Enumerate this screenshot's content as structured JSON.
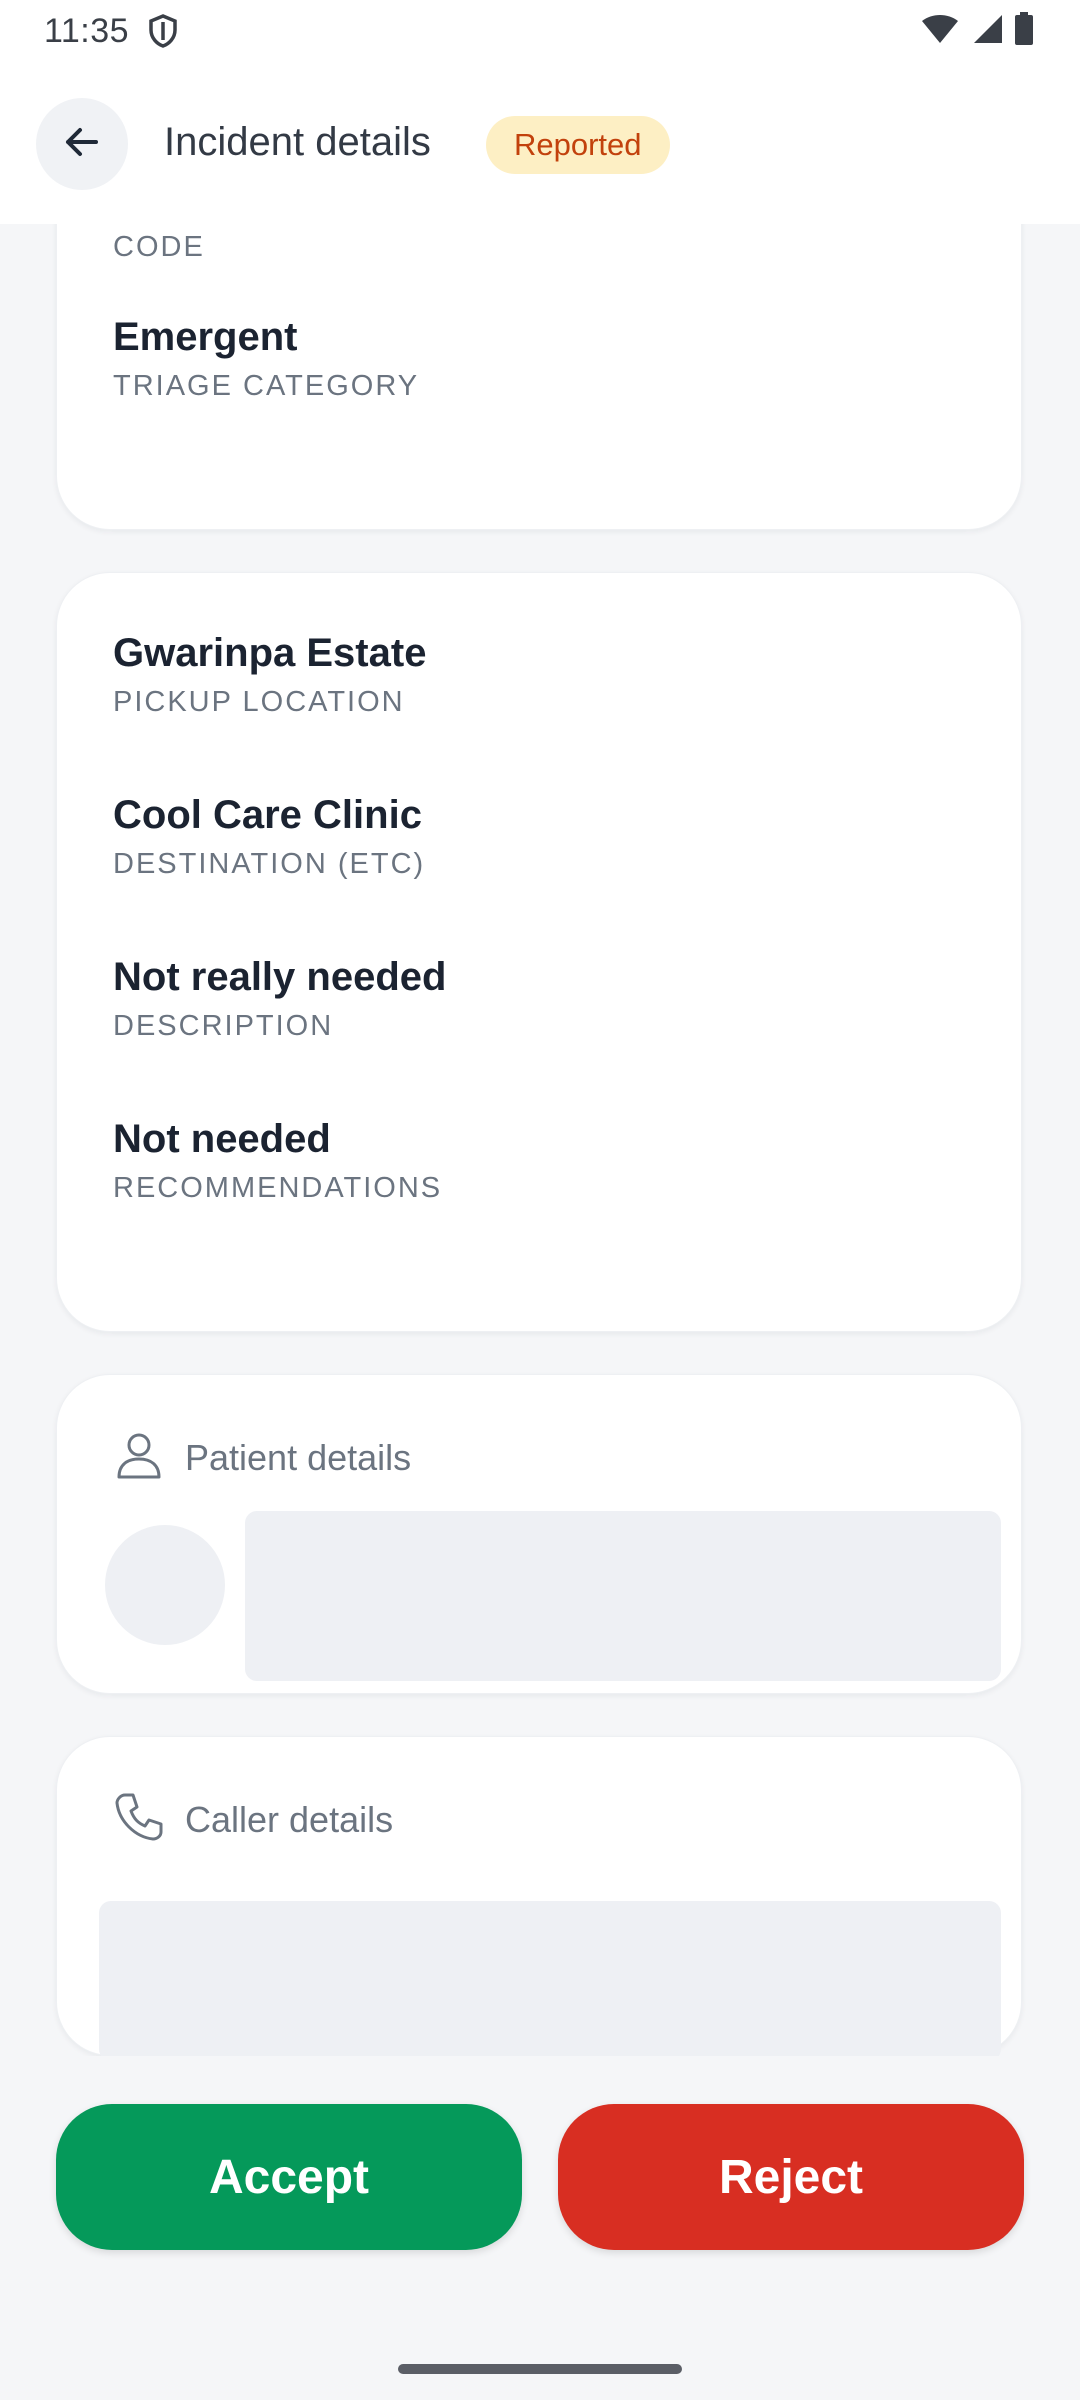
{
  "status_bar": {
    "time": "11:35",
    "icons": [
      "shield-icon",
      "wifi-icon",
      "signal-icon",
      "battery-icon"
    ]
  },
  "header": {
    "title": "Incident details",
    "status_badge": "Reported",
    "back_icon": "arrow-left-icon"
  },
  "triage_card": {
    "partial_label": "CODE",
    "fields": [
      {
        "value": "Emergent",
        "label": "TRIAGE CATEGORY"
      }
    ]
  },
  "location_card": {
    "fields": [
      {
        "value": "Gwarinpa Estate",
        "label": "PICKUP LOCATION"
      },
      {
        "value": "Cool Care Clinic",
        "label": "DESTINATION (ETC)"
      },
      {
        "value": "Not really needed",
        "label": "DESCRIPTION"
      },
      {
        "value": "Not needed",
        "label": "RECOMMENDATIONS"
      }
    ]
  },
  "patient_card": {
    "title": "Patient details",
    "icon": "person-icon"
  },
  "caller_card": {
    "title": "Caller details",
    "icon": "phone-icon"
  },
  "actions": {
    "accept_label": "Accept",
    "reject_label": "Reject"
  },
  "colors": {
    "accept": "#05995a",
    "reject": "#d82e22",
    "badge_bg": "#fdefc4",
    "badge_text": "#c2410c"
  }
}
